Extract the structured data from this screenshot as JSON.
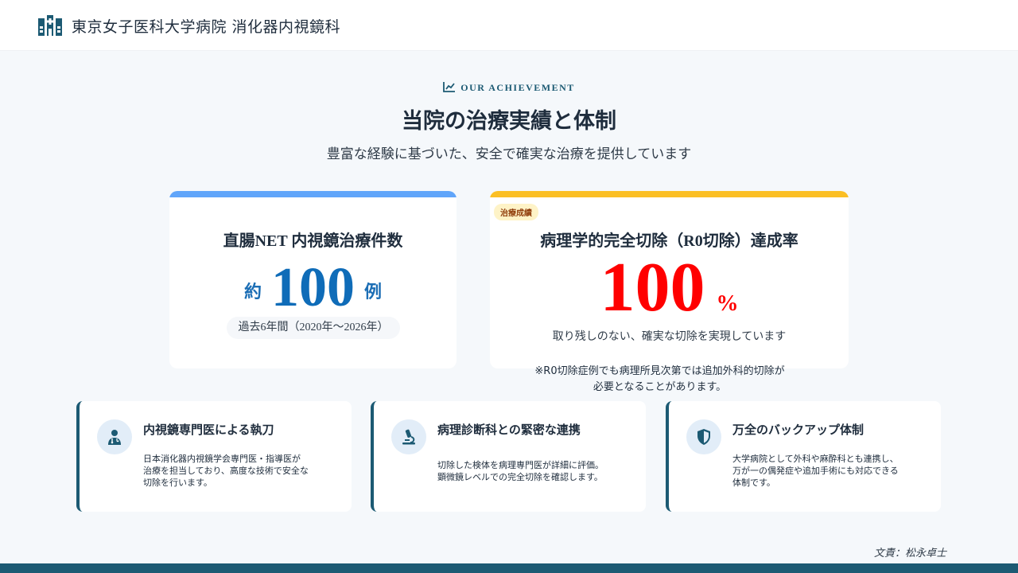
{
  "header": {
    "title": "東京女子医科大学病院 消化器内視鏡科",
    "logo_icon": "hospital-building-icon"
  },
  "section": {
    "eyebrow": "OUR ACHIEVEMENT",
    "eyebrow_icon": "chart-line-icon",
    "title": "当院の治療実績と体制",
    "subtitle": "豊富な経験に基づいた、安全で確実な治療を提供しています"
  },
  "card_cases": {
    "title": "直腸NET 内視鏡治療件数",
    "prefix": "約",
    "value": "100",
    "suffix": "例",
    "period": "過去6年間（2020年～2026年）",
    "accent_color": "#60a5fa"
  },
  "card_rate": {
    "badge": "治療成績",
    "title": "病理学的完全切除（R0切除）達成率",
    "value": "100",
    "unit": "%",
    "description": "取り残しのない、確実な切除を実現しています",
    "accent_color": "#fbbf24",
    "value_color": "#ff0000"
  },
  "note": {
    "line1": "※R0切除症例でも病理所見次第では追加外科的切除が",
    "line2": "必要となることがあります。"
  },
  "features": [
    {
      "icon": "doctor-icon",
      "title": "内視鏡専門医による執刀",
      "desc_lines": [
        "日本消化器内視鏡学会専門医・指導医が",
        "治療を担当しており、高度な技術で安全な",
        "切除を行います。"
      ]
    },
    {
      "icon": "microscope-icon",
      "title": "病理診断科との緊密な連携",
      "desc_lines": [
        "切除した検体を病理専門医が詳細に評価。",
        "顕微鏡レベルでの完全切除を確認します。"
      ]
    },
    {
      "icon": "shield-icon",
      "title": "万全のバックアップ体制",
      "desc_lines": [
        "大学病院として外科や麻酔科とも連携し、",
        "万が一の偶発症や追加手術にも対応できる",
        "体制です。"
      ]
    }
  ],
  "author": "文責：松永卓士",
  "colors": {
    "brand": "#1c5a73",
    "blue_value": "#0f6cb8"
  }
}
